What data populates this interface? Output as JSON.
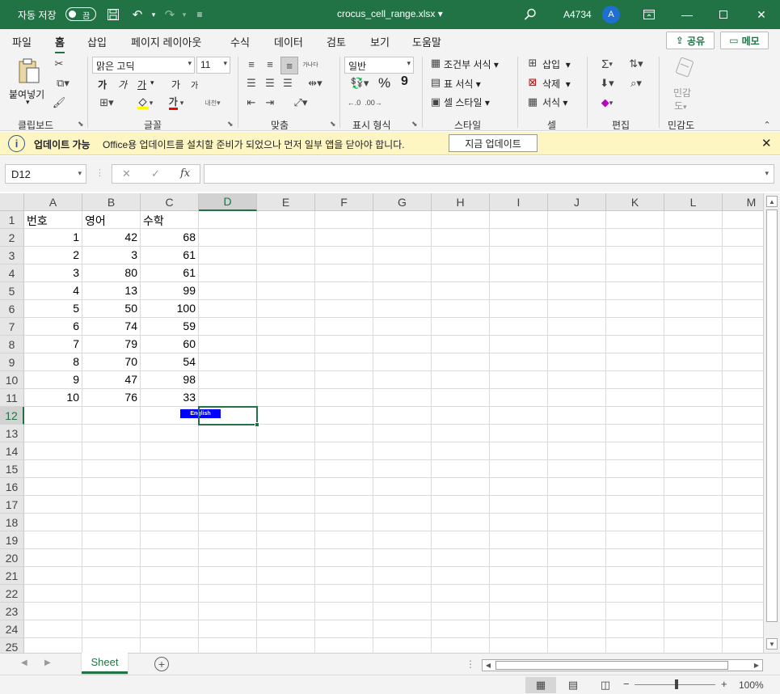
{
  "app": {
    "autosave_label": "자동 저장",
    "autosave_state": "끔",
    "filename": "crocus_cell_range.xlsx",
    "filename_caret": "▾",
    "user_name": "A4734",
    "avatar_initial": "A",
    "brand_color": "#217346"
  },
  "menu": {
    "tabs": [
      "파일",
      "홈",
      "삽입",
      "페이지 레이아웃",
      "수식",
      "데이터",
      "검토",
      "보기",
      "도움말"
    ],
    "active_tab": "홈",
    "share_label": "공유",
    "memo_label": "메모"
  },
  "ribbon": {
    "clipboard": {
      "paste_label": "붙여넣기",
      "group_label": "클립보드"
    },
    "font": {
      "font_name": "맑은 고딕",
      "font_size": "11",
      "group_label": "글꼴",
      "bold": "가",
      "italic": "가",
      "underline": "가",
      "grow": "가",
      "shrink": "가",
      "font_color_glyph": "가",
      "phonetic": "내천"
    },
    "alignment": {
      "group_label": "맞춤",
      "wrap": "가나다"
    },
    "number": {
      "format": "일반",
      "group_label": "표시 형식",
      "percent": "%",
      "comma": "9"
    },
    "styles": {
      "group_label": "스타일",
      "conditional": "조건부 서식",
      "table": "표 서식",
      "cell": "셀 스타일"
    },
    "cells": {
      "group_label": "셀",
      "insert": "삽입",
      "delete": "삭제",
      "format": "서식"
    },
    "editing": {
      "group_label": "편집"
    },
    "sensitivity": {
      "group_label": "민감도",
      "label1": "민감",
      "label2": "도"
    }
  },
  "notification": {
    "title": "업데이트 가능",
    "message": "Office용 업데이트를 설치할 준비가 되었으나 먼저 일부 앱을 닫아야 합니다.",
    "button": "지금 업데이트"
  },
  "formula_bar": {
    "name_box": "D12",
    "formula": ""
  },
  "grid": {
    "columns": [
      "A",
      "B",
      "C",
      "D",
      "E",
      "F",
      "G",
      "H",
      "I",
      "J",
      "K",
      "L",
      "M"
    ],
    "rows": [
      "1",
      "2",
      "3",
      "4",
      "5",
      "6",
      "7",
      "8",
      "9",
      "10",
      "11",
      "12",
      "13",
      "14",
      "15",
      "16",
      "17",
      "18",
      "19",
      "20",
      "21",
      "22",
      "23",
      "24",
      "25"
    ],
    "selected_column": "D",
    "selected_row": "12",
    "headers": [
      "번호",
      "영어",
      "수학"
    ],
    "data": [
      [
        "1",
        "42",
        "68"
      ],
      [
        "2",
        "3",
        "61"
      ],
      [
        "3",
        "80",
        "61"
      ],
      [
        "4",
        "13",
        "99"
      ],
      [
        "5",
        "50",
        "100"
      ],
      [
        "6",
        "74",
        "59"
      ],
      [
        "7",
        "79",
        "60"
      ],
      [
        "8",
        "70",
        "54"
      ],
      [
        "9",
        "47",
        "98"
      ],
      [
        "10",
        "76",
        "33"
      ]
    ],
    "english_tag": "English"
  },
  "sheets": {
    "tabs": [
      "Sheet"
    ],
    "active": "Sheet"
  },
  "status": {
    "zoom": "100%"
  }
}
